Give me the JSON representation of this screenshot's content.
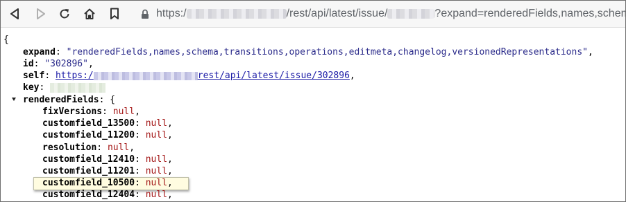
{
  "browser": {
    "url_scheme": "https:/",
    "url_path": "/rest/api/latest/issue/",
    "url_query": "?expand=renderedFields,names,schem"
  },
  "json": {
    "open_brace": "{",
    "expand": {
      "key": "expand",
      "value": "\"renderedFields,names,schema,transitions,operations,editmeta,changelog,versionedRepresentations\"",
      "sep": ","
    },
    "id": {
      "key": "id",
      "value": "\"302896\"",
      "sep": ","
    },
    "self": {
      "key": "self",
      "link_prefix": "https:/",
      "link_suffix": "rest/api/latest/issue/302896",
      "sep": ","
    },
    "key": {
      "key": "key"
    },
    "renderedFields": {
      "key": "renderedFields",
      "open": "{"
    },
    "fields": [
      {
        "key": "fixVersions",
        "value": "null",
        "sep": ","
      },
      {
        "key": "customfield_13500",
        "value": "null",
        "sep": ","
      },
      {
        "key": "customfield_11200",
        "value": "null",
        "sep": ","
      },
      {
        "key": "resolution",
        "value": "null",
        "sep": ","
      },
      {
        "key": "customfield_12410",
        "value": "null",
        "sep": ","
      },
      {
        "key": "customfield_11201",
        "value": "null",
        "sep": ","
      },
      {
        "key": "customfield_10500",
        "value": "null",
        "sep": ","
      },
      {
        "key": "customfield_12404",
        "value": "null",
        "sep": ","
      }
    ]
  },
  "colors": {
    "key": "#000000",
    "string": "#2a2a8a",
    "null": "#a31515",
    "link": "#1a1aa6",
    "highlight": "#fffce0"
  },
  "icons": [
    "back-icon",
    "forward-icon",
    "reload-icon",
    "home-icon",
    "bookmark-icon",
    "lock-icon"
  ]
}
